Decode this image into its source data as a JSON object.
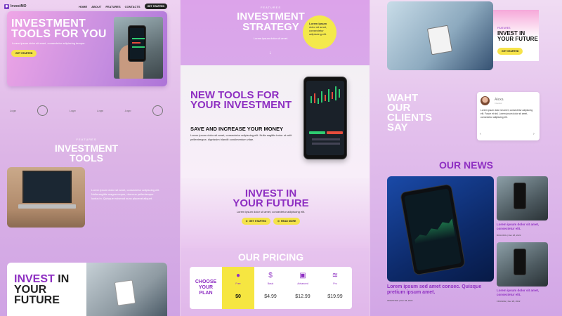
{
  "nav": {
    "logo": "InvestMO",
    "links": [
      "HOME",
      "ABOUT",
      "FEATURES",
      "CONTACTS"
    ],
    "cta": "GET STARTED"
  },
  "hero": {
    "title": "INVESTMENT TOOLS FOR YOU",
    "subtitle": "Lorem ipsum dolor sit amet, consectetur adipiscing tempor.",
    "button": "GET STARTED"
  },
  "brands": [
    "Logo",
    "Logo",
    "Logo",
    "Logo",
    "Logo",
    "Logo"
  ],
  "features": {
    "kicker": "FEATURES",
    "title": "INVESTMENT TOOLS",
    "text": "Lorem ipsum dolor sit amet, consectetur adipiscing elit. Nulla sagittis magna neque, rhoncus pellentesque luctus in. Quisque euismod nunc placerat aliquet."
  },
  "invest_card": {
    "title_highlight": "INVEST",
    "title_rest": " IN YOUR FUTURE"
  },
  "strategy": {
    "kicker": "FEATURES",
    "title": "INVESTMENT STRATEGY",
    "subtitle": "Lorem ipsum dolor sit amet.",
    "badge_bold": "Lorem ipsum",
    "badge_text": " dolor sit amet, consectetur adipiscing elit."
  },
  "tools": {
    "title": "NEW TOOLS FOR YOUR INVESTMENT",
    "subtitle": "SAVE AND INCREASE YOUR MONEY",
    "text": "Lorem ipsum dolor sit amet, consectetur adipiscing elit. Nulla sagittis tortor ut velit pellentesque, dignissim blandit condimentum vitae."
  },
  "future": {
    "title": "INVEST IN YOUR FUTURE",
    "subtitle": "Lorem ipsum dolor sit amet, consectetur adipiscing elit.",
    "btn1": "GET STARTED",
    "btn2": "READ MORE"
  },
  "pricing": {
    "title": "OUR PRICING",
    "label": "CHOOSE YOUR PLAN",
    "plans": [
      {
        "icon": "apple-icon",
        "glyph": "",
        "name": "Free",
        "price": "$0"
      },
      {
        "icon": "dollar-icon",
        "glyph": "$",
        "name": "Basic",
        "price": "$4.99"
      },
      {
        "icon": "shapes-icon",
        "glyph": "▣",
        "name": "Advanced",
        "price": "$12.99"
      },
      {
        "icon": "coins-icon",
        "glyph": "≋",
        "name": "Pro",
        "price": "$19.99"
      }
    ]
  },
  "right_card": {
    "kicker": "FEATURES",
    "title": "INVEST IN YOUR FUTURE",
    "button": "GET STARTED"
  },
  "clients": {
    "title": "WAHT OUR CLIENTS SAY",
    "name": "Alexa",
    "role": "Investor",
    "text": "Lorem ipsum dolor sit amet, consectetur adipiscing elit. Fusce et nisl. Lorem ipsum dolor sit amet, consectetur adipiscing elit."
  },
  "news": {
    "title": "OUR NEWS",
    "main_caption": "Lorem ipsum sed amet consec. Quisque pretium ipsum amet.",
    "main_meta": "INVESTING | Dec 28, 2022",
    "items": [
      {
        "caption": "Lorem ipsum dolor sit amet, consectetur elit.",
        "meta": "BUILDING | Dec 28, 2022"
      },
      {
        "caption": "Lorem ipsum dolor sit amet, consectetur elit.",
        "meta": "FINANCE | Dec 28, 2022"
      }
    ]
  }
}
